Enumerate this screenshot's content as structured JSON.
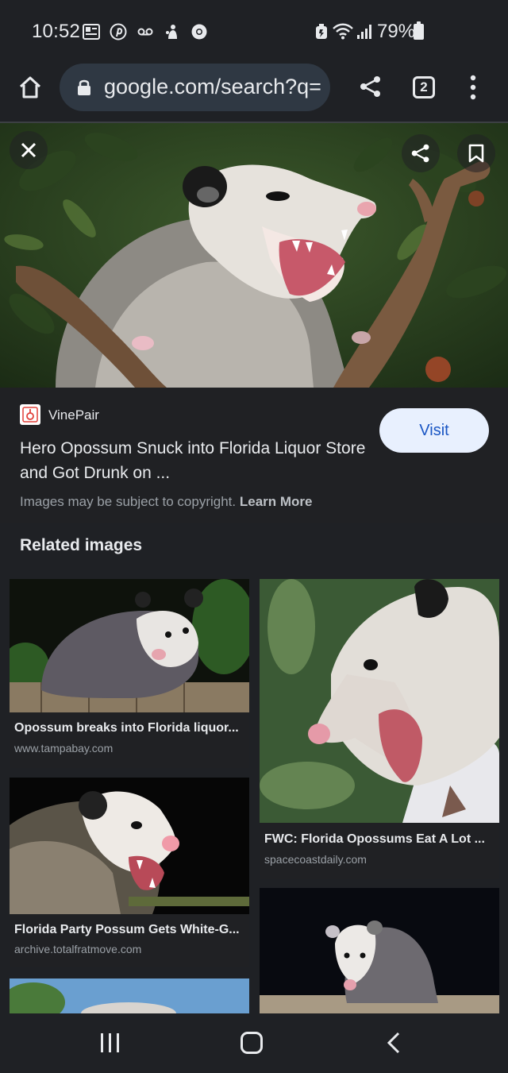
{
  "status_bar": {
    "time": "10:52",
    "battery": "79%",
    "left_icons": [
      "news-icon",
      "pinterest-icon",
      "voicemail-icon",
      "app-notification-icon",
      "chrome-icon"
    ],
    "right_icons": [
      "battery-saver-icon",
      "wifi-icon",
      "signal-icon",
      "battery-icon"
    ]
  },
  "toolbar": {
    "url": "google.com/search?q=",
    "tab_count": "2"
  },
  "hero": {
    "alt": "Opossum hissing on a branch"
  },
  "source": {
    "site": "VinePair",
    "title": "Hero Opossum Snuck into Florida Liquor Store and Got Drunk on ...",
    "visit_label": "Visit",
    "copyright_text": "Images may be subject to copyright.",
    "learn_more": "Learn More"
  },
  "related": {
    "heading": "Related images",
    "items": [
      {
        "title": "Opossum breaks into Florida liquor...",
        "domain": "www.tampabay.com"
      },
      {
        "title": "FWC: Florida Opossums Eat A Lot ...",
        "domain": "spacecoastdaily.com"
      },
      {
        "title": "Florida Party Possum Gets White-G...",
        "domain": "archive.totalfratmove.com"
      },
      {
        "title": "",
        "domain": ""
      },
      {
        "title": "",
        "domain": ""
      }
    ]
  },
  "colors": {
    "background": "#1f2125",
    "visit_button_bg": "#e8f0fe",
    "visit_button_text": "#1a56c4",
    "omnibox_bg": "#2f3843"
  }
}
